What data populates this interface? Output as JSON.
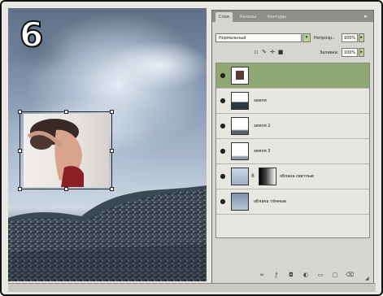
{
  "step_number": "6",
  "panel": {
    "tabs": [
      "Слои",
      "Каналы",
      "Контуры"
    ],
    "blend_mode": "Нормальный",
    "opacity_label": "Непрозр.:",
    "opacity_value": "100%",
    "fill_label": "Заливка:",
    "fill_value": "100%",
    "layers": [
      {
        "name": "",
        "selected": true,
        "has_mask": false
      },
      {
        "name": "земля",
        "selected": false,
        "has_mask": false
      },
      {
        "name": "земля 2",
        "selected": false,
        "has_mask": false
      },
      {
        "name": "земля 3",
        "selected": false,
        "has_mask": false
      },
      {
        "name": "облака светлые",
        "selected": false,
        "has_mask": true
      },
      {
        "name": "облака тёмные",
        "selected": false,
        "has_mask": false
      }
    ]
  },
  "icons": {
    "visibility": "eye-icon",
    "lock_transparency": "lock-transparency-icon",
    "lock_image": "brush-icon",
    "lock_position": "move-icon",
    "lock_all": "lock-icon",
    "link": "chain-icon",
    "bottom_bar": [
      "link-layers-icon",
      "fx-icon",
      "mask-icon",
      "adjustment-icon",
      "folder-icon",
      "new-layer-icon",
      "trash-icon"
    ]
  }
}
